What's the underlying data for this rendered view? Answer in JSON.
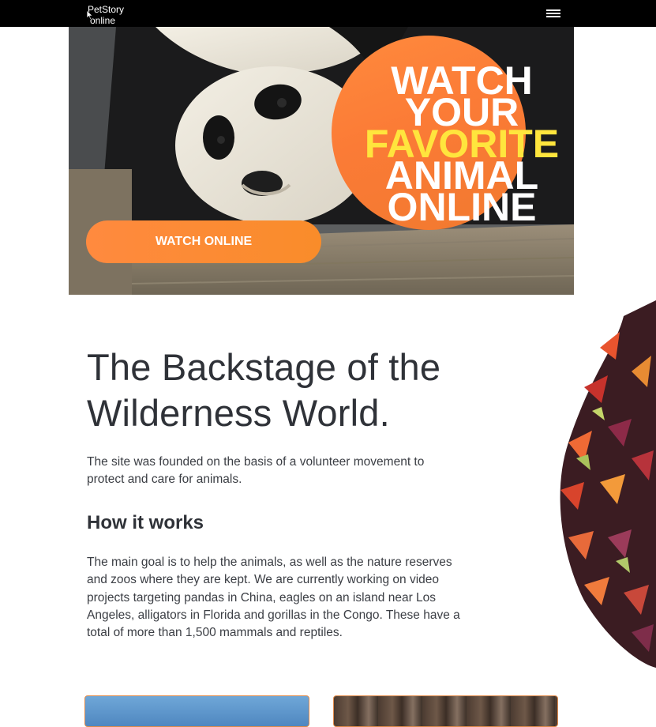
{
  "header": {
    "logo_line1": "PetStory",
    "logo_line2": "online",
    "menu_icon": "hamburger-menu-icon"
  },
  "hero": {
    "headline": {
      "line1": "WATCH",
      "line2": "YOUR",
      "line3": "FAVORITE",
      "line4": "ANIMAL",
      "line5": "ONLINE"
    },
    "cta_label": "WATCH ONLINE"
  },
  "colors": {
    "accent_orange": "#f9803a",
    "accent_yellow": "#ffe53d",
    "topbar": "#000000",
    "text": "#2f3238"
  },
  "about": {
    "title": "The Backstage of the Wilderness World.",
    "intro": "The site was founded on the basis of a volunteer movement to protect and care for animals.",
    "subheading": "How it works",
    "body": "The main goal is to help the animals, as well as the nature reserves and zoos where they are kept. We are currently working on video projects targeting pandas in China, eagles on an island near Los Angeles, alligators in Florida and gorillas in the Congo. These have a total of more than 1,500 mammals and reptiles."
  }
}
